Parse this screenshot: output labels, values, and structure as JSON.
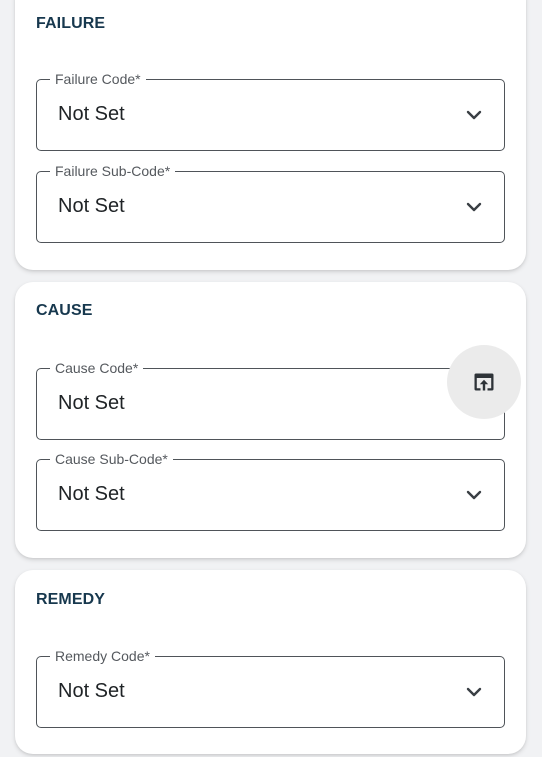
{
  "sections": {
    "failure": {
      "title": "FAILURE",
      "fields": [
        {
          "label": "Failure Code*",
          "value": "Not Set"
        },
        {
          "label": "Failure Sub-Code*",
          "value": "Not Set"
        }
      ]
    },
    "cause": {
      "title": "CAUSE",
      "fields": [
        {
          "label": "Cause Code*",
          "value": "Not Set"
        },
        {
          "label": "Cause Sub-Code*",
          "value": "Not Set"
        }
      ]
    },
    "remedy": {
      "title": "REMEDY",
      "fields": [
        {
          "label": "Remedy Code*",
          "value": "Not Set"
        }
      ]
    }
  },
  "fab": {
    "icon": "open-in-browser-icon"
  },
  "colors": {
    "section_title": "#17384e",
    "field_border": "#4f5459",
    "field_label": "#55595e",
    "field_value": "#1f2326",
    "fab_background": "#ebebeb"
  }
}
